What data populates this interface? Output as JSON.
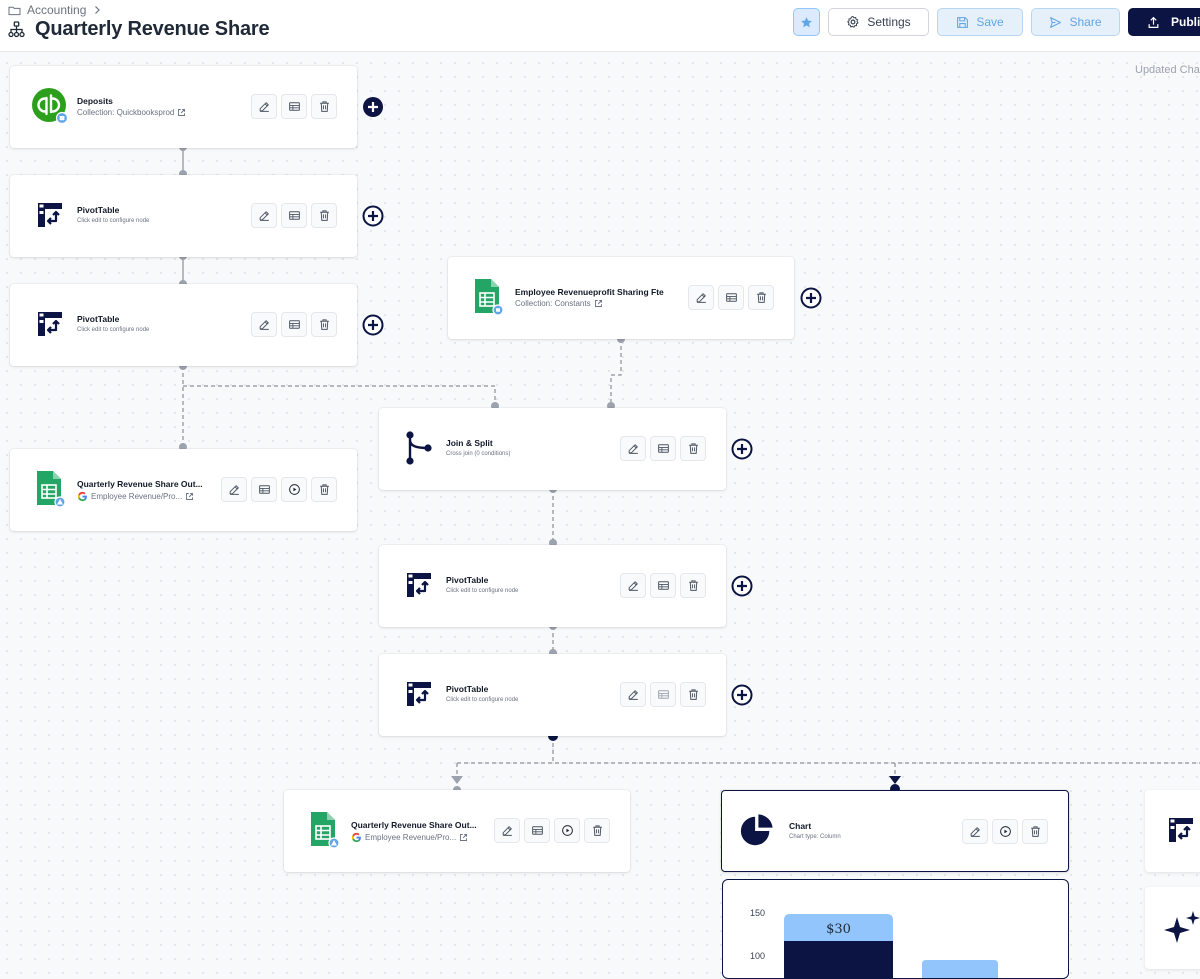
{
  "header": {
    "breadcrumb": "Accounting",
    "title": "Quarterly Revenue Share",
    "settings_label": "Settings",
    "save_label": "Save",
    "share_label": "Share",
    "publish_label": "Publish",
    "updated_text": "Updated Cha"
  },
  "nodes": {
    "deposits": {
      "title": "Deposits",
      "subtitle": "Collection: Quickbooksprod"
    },
    "pivot1": {
      "title": "PivotTable",
      "subtitle": "Click edit to configure node"
    },
    "pivot2": {
      "title": "PivotTable",
      "subtitle": "Click edit to configure node"
    },
    "employee": {
      "title": "Employee Revenueprofit Sharing Fte",
      "subtitle": "Collection: Constants"
    },
    "output1": {
      "title": "Quarterly Revenue Share Out...",
      "subtitle": "Employee Revenue/Pro..."
    },
    "join": {
      "title": "Join & Split",
      "subtitle": "Cross join (0 conditions)"
    },
    "pivot3": {
      "title": "PivotTable",
      "subtitle": "Click edit to configure node"
    },
    "pivot4": {
      "title": "PivotTable",
      "subtitle": "Click edit to configure node"
    },
    "output2": {
      "title": "Quarterly Revenue Share Out...",
      "subtitle": "Employee Revenue/Pro..."
    },
    "chart": {
      "title": "Chart",
      "subtitle": "Chart type: Column"
    }
  },
  "chart_preview": {
    "y_ticks": [
      "150",
      "100"
    ],
    "bar_label": "$30"
  },
  "colors": {
    "navy": "#0b1442",
    "sheets_green": "#23a566",
    "quickbooks_green": "#2ca01c",
    "chart_light_blue": "#93c5fd"
  }
}
